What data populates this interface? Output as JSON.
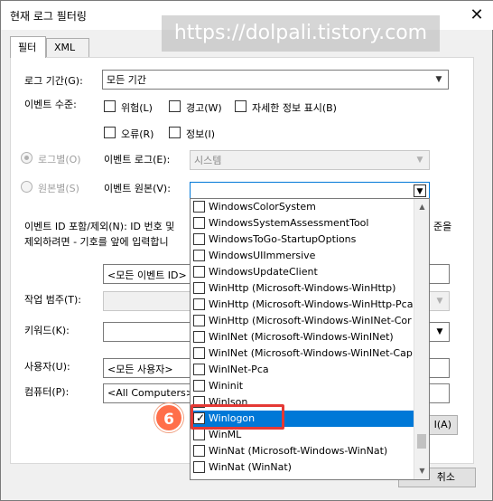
{
  "dialog": {
    "title": "현재 로그 필터링",
    "close_icon": "close-icon"
  },
  "watermark": "https://dolpali.tistory.com",
  "tabs": [
    {
      "label": "필터"
    },
    {
      "label": "XML"
    }
  ],
  "filter": {
    "log_period": {
      "label": "로그 기간(G):",
      "value": "모든 기간"
    },
    "event_level": {
      "label": "이벤트 수준:",
      "options": [
        {
          "label": "위험(L)"
        },
        {
          "label": "경고(W)"
        },
        {
          "label": "자세한 정보 표시(B)"
        },
        {
          "label": "오류(R)"
        },
        {
          "label": "정보(I)"
        }
      ]
    },
    "by_log": {
      "label": "로그별(O)"
    },
    "by_source": {
      "label": "원본별(S)"
    },
    "event_log": {
      "label": "이벤트 로그(E):",
      "value": "시스템"
    },
    "event_source": {
      "label": "이벤트 원본(V):",
      "value": ""
    },
    "id_help": {
      "line1": "이벤트 ID 포함/제외(N): ID 번호 및",
      "line1_right": "준을",
      "line2": "제외하려면 - 기호를 앞에 입력합니"
    },
    "all_event_ids": "<모든 이벤트 ID>",
    "task_category": {
      "label": "작업 범주(T):"
    },
    "keywords": {
      "label": "키워드(K):"
    },
    "user": {
      "label": "사용자(U):",
      "value": "<모든 사용자>"
    },
    "computer": {
      "label": "컴퓨터(P):",
      "value": "<All Computers>"
    },
    "clear_button_fragment": "I(A)",
    "cancel_button": "취소"
  },
  "source_list": [
    {
      "label": "WindowsColorSystem",
      "checked": false
    },
    {
      "label": "WindowsSystemAssessmentTool",
      "checked": false
    },
    {
      "label": "WindowsToGo-StartupOptions",
      "checked": false
    },
    {
      "label": "WindowsUIImmersive",
      "checked": false
    },
    {
      "label": "WindowsUpdateClient",
      "checked": false
    },
    {
      "label": "WinHttp (Microsoft-Windows-WinHttp)",
      "checked": false
    },
    {
      "label": "WinHttp (Microsoft-Windows-WinHttp-Pca",
      "checked": false
    },
    {
      "label": "WinHttp (Microsoft-Windows-WinINet-Cor",
      "checked": false
    },
    {
      "label": "WinINet (Microsoft-Windows-WinINet)",
      "checked": false
    },
    {
      "label": "WinINet (Microsoft-Windows-WinINet-Cap",
      "checked": false
    },
    {
      "label": "WinINet-Pca",
      "checked": false
    },
    {
      "label": "Wininit",
      "checked": false
    },
    {
      "label": "WinJson",
      "checked": false
    },
    {
      "label": "Winlogon",
      "checked": true
    },
    {
      "label": "WinML",
      "checked": false
    },
    {
      "label": "WinNat (Microsoft-Windows-WinNat)",
      "checked": false
    },
    {
      "label": "WinNat (WinNat)",
      "checked": false
    }
  ],
  "step_badge": "6",
  "colors": {
    "selection": "#0078d7",
    "highlight": "#e53935",
    "badge": "#ff6f4a"
  }
}
